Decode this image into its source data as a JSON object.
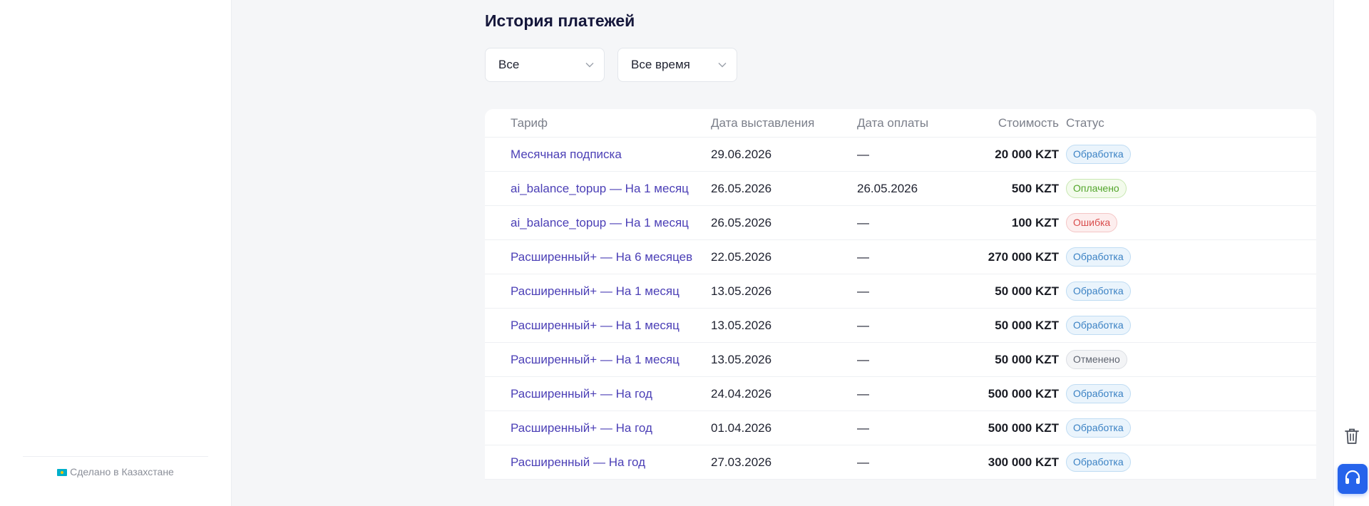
{
  "sidebar": {
    "footer_text": "Сделано в Казахстане"
  },
  "page": {
    "title": "История платежей"
  },
  "filters": {
    "type_value": "Все",
    "period_value": "Все время"
  },
  "table": {
    "headers": {
      "plan": "Тариф",
      "issued": "Дата выставления",
      "paid": "Дата оплаты",
      "cost": "Стоимость",
      "status": "Статус"
    },
    "rows": [
      {
        "plan": "Месячная подписка",
        "issued": "29.06.2026",
        "paid": "—",
        "cost": "20 000 KZT",
        "status": "Обработка"
      },
      {
        "plan": "ai_balance_topup — На 1 месяц",
        "issued": "26.05.2026",
        "paid": "26.05.2026",
        "cost": "500 KZT",
        "status": "Оплачено"
      },
      {
        "plan": "ai_balance_topup — На 1 месяц",
        "issued": "26.05.2026",
        "paid": "—",
        "cost": "100 KZT",
        "status": "Ошибка"
      },
      {
        "plan": "Расширенный+ — На 6 месяцев",
        "issued": "22.05.2026",
        "paid": "—",
        "cost": "270 000 KZT",
        "status": "Обработка"
      },
      {
        "plan": "Расширенный+ — На 1 месяц",
        "issued": "13.05.2026",
        "paid": "—",
        "cost": "50 000 KZT",
        "status": "Обработка"
      },
      {
        "plan": "Расширенный+ — На 1 месяц",
        "issued": "13.05.2026",
        "paid": "—",
        "cost": "50 000 KZT",
        "status": "Обработка"
      },
      {
        "plan": "Расширенный+ — На 1 месяц",
        "issued": "13.05.2026",
        "paid": "—",
        "cost": "50 000 KZT",
        "status": "Отменено"
      },
      {
        "plan": "Расширенный+ — На год",
        "issued": "24.04.2026",
        "paid": "—",
        "cost": "500 000 KZT",
        "status": "Обработка"
      },
      {
        "plan": "Расширенный+ — На год",
        "issued": "01.04.2026",
        "paid": "—",
        "cost": "500 000 KZT",
        "status": "Обработка"
      },
      {
        "plan": "Расширенный — На год",
        "issued": "27.03.2026",
        "paid": "—",
        "cost": "300 000 KZT",
        "status": "Обработка"
      }
    ]
  },
  "icons": {
    "trash": "trash-icon",
    "support": "headphones-icon",
    "flag": "kazakhstan-flag-icon"
  },
  "colors": {
    "accent": "#2563eb",
    "link": "#4b3fb6",
    "processing": "#3b82c4",
    "paid": "#52a52b",
    "error": "#d94c4c",
    "cancelled": "#5f6470"
  }
}
